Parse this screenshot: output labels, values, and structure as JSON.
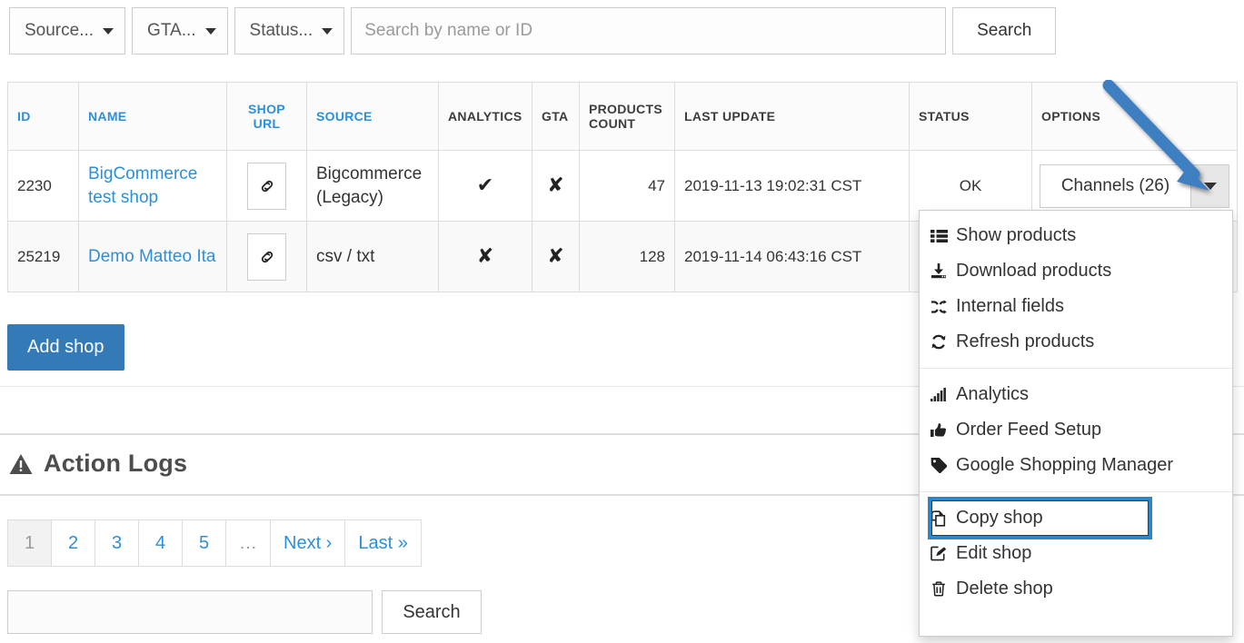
{
  "filters": {
    "source": {
      "label": "Source...",
      "caret_icon": "caret-down-icon"
    },
    "gta": {
      "label": "GTA...",
      "caret_icon": "caret-down-icon"
    },
    "status": {
      "label": "Status...",
      "caret_icon": "caret-down-icon"
    },
    "search": {
      "value": "",
      "placeholder": "Search by name or ID"
    },
    "search_button": "Search"
  },
  "table": {
    "columns": [
      {
        "key": "id",
        "label": "ID",
        "sortable": true
      },
      {
        "key": "name",
        "label": "NAME",
        "sortable": true
      },
      {
        "key": "shop_url",
        "label": "SHOP URL",
        "sortable": true
      },
      {
        "key": "source",
        "label": "SOURCE",
        "sortable": true
      },
      {
        "key": "analytics",
        "label": "ANALYTICS",
        "sortable": false
      },
      {
        "key": "gta",
        "label": "GTA",
        "sortable": false
      },
      {
        "key": "products_count",
        "label": "PRODUCTS COUNT",
        "sortable": false
      },
      {
        "key": "last_update",
        "label": "LAST UPDATE",
        "sortable": false
      },
      {
        "key": "status",
        "label": "STATUS",
        "sortable": false
      },
      {
        "key": "options",
        "label": "OPTIONS",
        "sortable": false
      }
    ],
    "rows": [
      {
        "id": "2230",
        "name": "BigCommerce test shop",
        "shop_url_icon": "link-icon",
        "source": "Bigcommerce (Legacy)",
        "analytics": "✔",
        "gta": "✘",
        "products_count": "47",
        "last_update": "2019-11-13 19:02:31 CST",
        "status": "OK",
        "options_label": "Channels (26)"
      },
      {
        "id": "25219",
        "name": "Demo Matteo Ita",
        "shop_url_icon": "link-icon",
        "source": "csv / txt",
        "analytics": "✘",
        "gta": "✘",
        "products_count": "128",
        "last_update": "2019-11-14 06:43:16 CST",
        "status": "",
        "options_label": ""
      }
    ]
  },
  "add_shop_button": "Add shop",
  "action_logs": {
    "icon": "warning-triangle-icon",
    "title": "Action Logs"
  },
  "pagination": {
    "pages": [
      {
        "label": "1",
        "active": true
      },
      {
        "label": "2",
        "active": false
      },
      {
        "label": "3",
        "active": false
      },
      {
        "label": "4",
        "active": false
      },
      {
        "label": "5",
        "active": false
      },
      {
        "label": "…",
        "gap": true
      },
      {
        "label": "Next ›",
        "active": false
      },
      {
        "label": "Last »",
        "active": false
      }
    ]
  },
  "bottom_search": {
    "value": "",
    "placeholder": "",
    "button": "Search"
  },
  "options_menu": {
    "groups": [
      {
        "items": [
          {
            "icon": "list-icon",
            "label": "Show products"
          },
          {
            "icon": "download-icon",
            "label": "Download products"
          },
          {
            "icon": "shuffle-icon",
            "label": "Internal fields"
          },
          {
            "icon": "refresh-icon",
            "label": "Refresh products"
          }
        ]
      },
      {
        "items": [
          {
            "icon": "bar-chart-icon",
            "label": "Analytics"
          },
          {
            "icon": "thumbs-up-icon",
            "label": "Order Feed Setup"
          },
          {
            "icon": "tag-icon",
            "label": "Google Shopping Manager"
          }
        ]
      },
      {
        "items": [
          {
            "icon": "copy-icon",
            "label": "Copy shop",
            "highlighted": true
          },
          {
            "icon": "edit-icon",
            "label": "Edit shop"
          },
          {
            "icon": "trash-icon",
            "label": "Delete shop"
          }
        ]
      }
    ]
  },
  "annotation": {
    "type": "arrow",
    "color": "#3c7fc0",
    "points_to": "options-dropdown-toggle"
  },
  "colors": {
    "link": "#2b90d9",
    "primary_button": "#337ab7",
    "status_ok": "#5cb85c",
    "annotation_blue": "#3c7fc0",
    "highlight_blue": "#2e86c9",
    "border": "#dddddd",
    "row_stripe": "#f9f9f9"
  }
}
